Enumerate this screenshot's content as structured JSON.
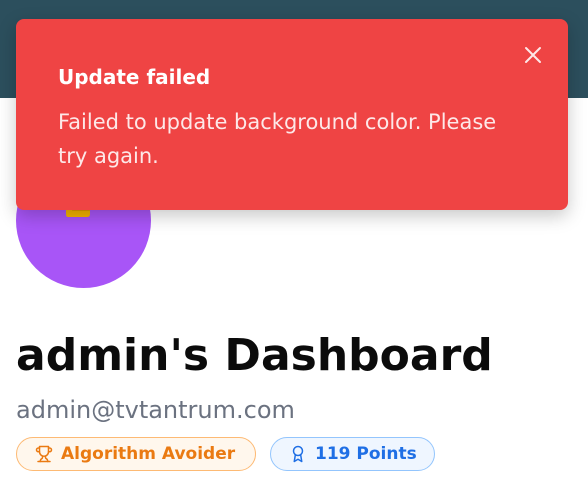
{
  "toast": {
    "title": "Update failed",
    "description": "Failed to update background color. Please try again.",
    "close_icon": "close-icon",
    "color": "#ef4444"
  },
  "profile": {
    "title": "admin's Dashboard",
    "email": "admin@tvtantrum.com",
    "avatar_color": "#a855f7"
  },
  "badges": {
    "achievement": {
      "label": "Algorithm Avoider",
      "icon": "trophy-icon"
    },
    "points": {
      "label": "119 Points",
      "icon": "award-ribbon-icon"
    }
  },
  "header": {
    "color": "#2c4f5d"
  }
}
